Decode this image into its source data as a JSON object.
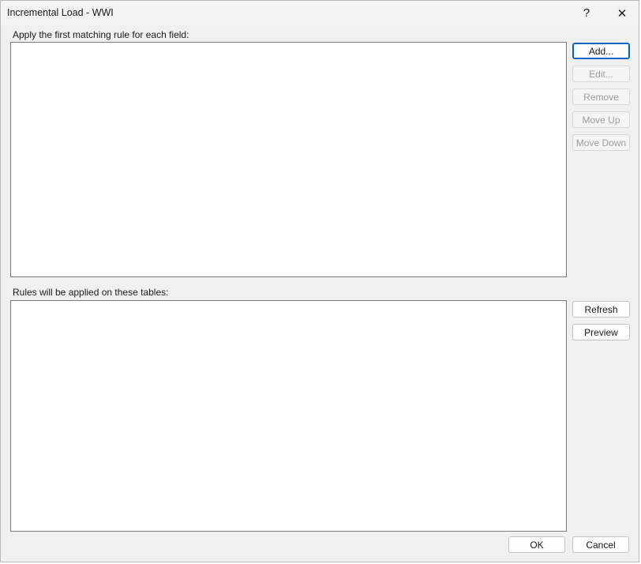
{
  "window": {
    "title": "Incremental Load - WWI",
    "help_glyph": "?",
    "close_glyph": "✕"
  },
  "rules_section": {
    "label": "Apply the first matching rule for each field:",
    "buttons": {
      "add": "Add...",
      "edit": "Edit...",
      "remove": "Remove",
      "move_up": "Move Up",
      "move_down": "Move Down"
    },
    "button_states": {
      "edit": "disabled",
      "remove": "disabled",
      "move_up": "disabled",
      "move_down": "disabled"
    }
  },
  "tables_section": {
    "label": "Rules will be applied on these tables:",
    "buttons": {
      "refresh": "Refresh",
      "preview": "Preview"
    }
  },
  "footer": {
    "ok": "OK",
    "cancel": "Cancel"
  },
  "colors": {
    "dialog_background": "#f0f0f0",
    "default_button_border": "#0067c0",
    "disabled_text": "#9d9d9d"
  },
  "icons": {
    "help": "help-icon",
    "close": "close-icon"
  }
}
